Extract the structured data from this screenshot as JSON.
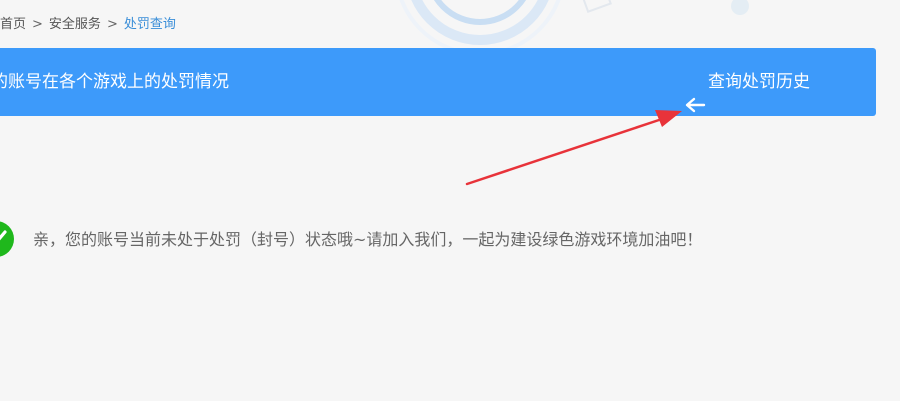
{
  "breadcrumb": {
    "home": "首页",
    "separator": ">",
    "security": "安全服务",
    "current": "处罚查询"
  },
  "banner": {
    "title": "的账号在各个游戏上的处罚情况",
    "history_link": "查询处罚历史",
    "history_icon": "arrow-left-icon"
  },
  "status": {
    "icon": "check-circle-icon",
    "message": "亲，您的账号当前未处于处罚（封号）状态哦~请加入我们，一起为建设绿色游戏环境加油吧！"
  },
  "colors": {
    "banner": "#3d9afa",
    "link_current": "#3a8ed8",
    "ok_green": "#1fb81c",
    "annotation_red": "#e8333a",
    "page_bg": "#f6f6f6"
  }
}
